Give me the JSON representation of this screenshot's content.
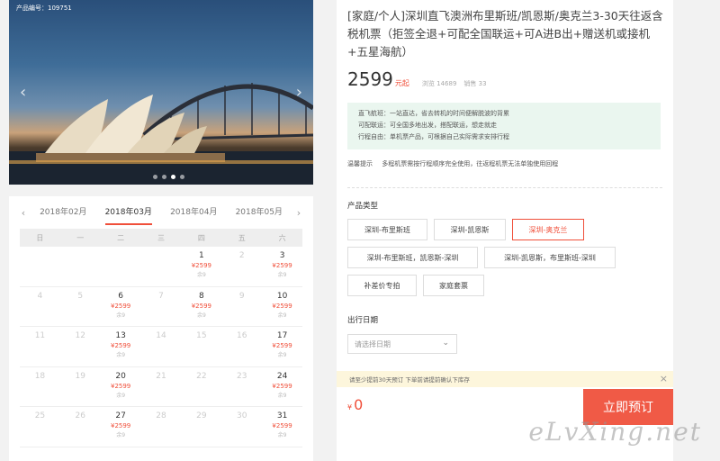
{
  "hero": {
    "product_code": "产品编号：109751",
    "prev_arrow": "‹",
    "next_arrow": "›",
    "slides": 4,
    "active_slide": 2
  },
  "calendar": {
    "prev": "‹",
    "next": "›",
    "months": [
      "2018年02月",
      "2018年03月",
      "2018年04月",
      "2018年05月"
    ],
    "active_month": 1,
    "weekdays": [
      "日",
      "一",
      "二",
      "三",
      "四",
      "五",
      "六"
    ],
    "weeks": [
      [
        {
          "d": ""
        },
        {
          "d": ""
        },
        {
          "d": ""
        },
        {
          "d": ""
        },
        {
          "d": "1",
          "p": "¥2599",
          "s": "余9"
        },
        {
          "d": "2"
        },
        {
          "d": "3",
          "p": "¥2599",
          "s": "余9"
        }
      ],
      [
        {
          "d": "4"
        },
        {
          "d": "5"
        },
        {
          "d": "6",
          "p": "¥2599",
          "s": "余9"
        },
        {
          "d": "7"
        },
        {
          "d": "8",
          "p": "¥2599",
          "s": "余9"
        },
        {
          "d": "9"
        },
        {
          "d": "10",
          "p": "¥2599",
          "s": "余9"
        }
      ],
      [
        {
          "d": "11"
        },
        {
          "d": "12"
        },
        {
          "d": "13",
          "p": "¥2599",
          "s": "余9"
        },
        {
          "d": "14"
        },
        {
          "d": "15"
        },
        {
          "d": "16"
        },
        {
          "d": "17",
          "p": "¥2599",
          "s": "余9"
        }
      ],
      [
        {
          "d": "18"
        },
        {
          "d": "19"
        },
        {
          "d": "20",
          "p": "¥2599",
          "s": "余9"
        },
        {
          "d": "21"
        },
        {
          "d": "22"
        },
        {
          "d": "23"
        },
        {
          "d": "24",
          "p": "¥2599",
          "s": "余9"
        }
      ],
      [
        {
          "d": "25"
        },
        {
          "d": "26"
        },
        {
          "d": "27",
          "p": "¥2599",
          "s": "余9"
        },
        {
          "d": "28"
        },
        {
          "d": "29"
        },
        {
          "d": "30"
        },
        {
          "d": "31",
          "p": "¥2599",
          "s": "余9"
        }
      ]
    ]
  },
  "product": {
    "title": "[家庭/个人]深圳直飞澳洲布里斯班/凯恩斯/奥克兰3-30天往返含税机票（拒签全退+可配全国联运+可A进B出+赠送机或接机+五星海航）",
    "price": "2599",
    "price_unit": "元起",
    "views": "浏览 14689",
    "sales": "销售 33",
    "notes": [
      "直飞航班：一站直达，省去转机的时间便解脱波的背累",
      "可配联运：可全国多地出发，搭配联运，想走就走",
      "行程自由：单机票产品，可根据自己实际需求安排行程"
    ],
    "tip_label": "温馨提示",
    "tip_text": "多程机票需按行程顺序完全使用，往返程机票无法单独使用回程"
  },
  "product_type": {
    "label": "产品类型",
    "options": [
      "深圳-布里斯班",
      "深圳-凯恩斯",
      "深圳-奥克兰",
      "深圳-布里斯班，凯恩斯-深圳",
      "深圳-凯恩斯，布里斯班-深圳",
      "补差价专拍",
      "家庭套票"
    ],
    "active_index": 2
  },
  "travel_date": {
    "label": "出行日期",
    "placeholder": "请选择日期"
  },
  "booking": {
    "notice": "请至少提前30天预订 下单前请提前确认下库存",
    "currency": "¥",
    "total": "0",
    "book_label": "立即预订"
  },
  "watermark": "eLvXing.net",
  "colors": {
    "accent": "#f04f3a",
    "note_bg": "#eaf6ef",
    "notice_bg": "#fdf6dc"
  }
}
